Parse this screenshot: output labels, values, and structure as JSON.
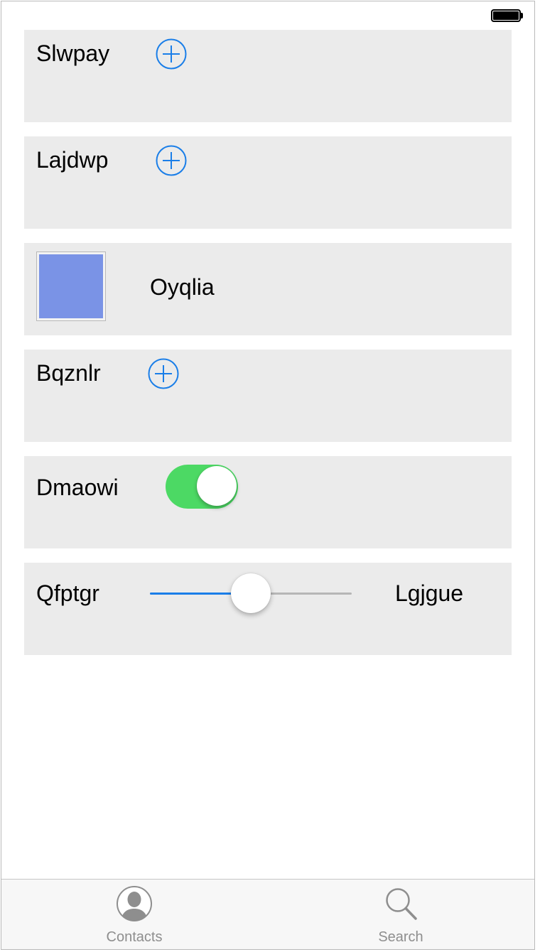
{
  "colors": {
    "row_background": "#ebebeb",
    "accent_blue": "#1a7ee8",
    "toggle_on_green": "#4cd964",
    "swatch_fill": "#7a93e6",
    "tab_inactive": "#8e8e8e"
  },
  "status_bar": {
    "battery_icon": "battery-full-icon"
  },
  "rows": {
    "row1": {
      "label": "Slwpay",
      "icon": "plus-circle-icon"
    },
    "row2": {
      "label": "Lajdwp",
      "icon": "plus-circle-icon"
    },
    "row3": {
      "label": "Oyqlia",
      "swatch_color": "#7a93e6"
    },
    "row4": {
      "label": "Bqznlr",
      "icon": "plus-circle-icon"
    },
    "row5": {
      "label": "Dmaowi",
      "toggle_on": true
    },
    "row6": {
      "label": "Qfptgr",
      "slider_value": 0.5,
      "right_label": "Lgjgue"
    }
  },
  "tabbar": {
    "tabs": [
      {
        "label": "Contacts",
        "icon": "contacts-person-icon"
      },
      {
        "label": "Search",
        "icon": "magnifier-search-icon"
      }
    ]
  }
}
